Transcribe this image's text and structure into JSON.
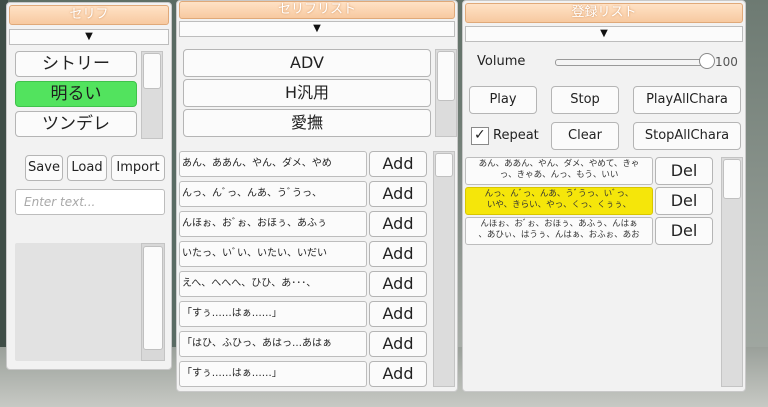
{
  "serif_panel": {
    "title": "セリフ",
    "dropdown_arrow": "▼",
    "types": [
      "シトリー",
      "明るい",
      "ツンデレ"
    ],
    "selected_index": 1,
    "save_label": "Save",
    "load_label": "Load",
    "import_label": "Import",
    "text_placeholder": "Enter text..."
  },
  "list_panel": {
    "title": "セリフリスト",
    "dropdown_arrow": "▼",
    "categories": [
      "ADV",
      "H汎用",
      "愛撫"
    ],
    "add_label": "Add",
    "items": [
      "あん、ああん、やん、ダメ、やめ",
      "んっ、んﾞっ、んあ、うﾞうっ、",
      "んほぉ、おﾞぉ、おほぅ、あふぅ",
      "いたっ、いﾞい、いたい、いだい",
      "えへ、へへへ、ひひ、あ･･･、",
      "「すぅ……はぁ……」",
      "「はひ、ふひっ、あはっ…あはぁ",
      "「すぅ……はぁ……」"
    ]
  },
  "registered_panel": {
    "title": "登録リスト",
    "dropdown_arrow": "▼",
    "volume_label": "Volume",
    "volume_value": "100",
    "volume_level": 1.0,
    "play_label": "Play",
    "stop_label": "Stop",
    "play_all_label": "PlayAllChara",
    "repeat_label": "Repeat",
    "repeat_checked": true,
    "checkmark": "✓",
    "clear_label": "Clear",
    "stop_all_label": "StopAllChara",
    "del_label": "Del",
    "highlight_color": "#f5e60a",
    "items": [
      {
        "line1": "あん、ああん、やん、ダメ、やめて、きゃ",
        "line2": "っ、きゃあ、んっ、もう、いい",
        "active": false
      },
      {
        "line1": "んっ、んﾞっ、んあ、うﾞうっ、いﾞっ、",
        "line2": "いや、きらい、やっ、くっ、くぅぅ、",
        "active": true
      },
      {
        "line1": "んほぉ、おﾞぉ、おほぅ、あふぅ、んはぁ",
        "line2": "、あひぃ、はうぅ、んはぁ、おふぉ、あお",
        "active": false
      }
    ]
  }
}
